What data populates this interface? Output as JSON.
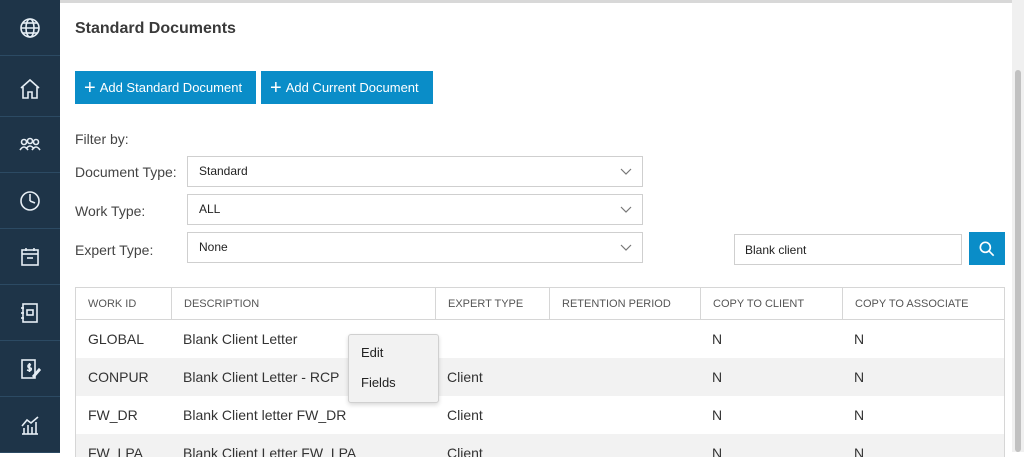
{
  "sidebar": {
    "items": [
      {
        "icon": "globe-icon"
      },
      {
        "icon": "home-icon"
      },
      {
        "icon": "users-icon"
      },
      {
        "icon": "dashboard-icon"
      },
      {
        "icon": "calendar-icon"
      },
      {
        "icon": "notebook-icon"
      },
      {
        "icon": "billing-icon"
      },
      {
        "icon": "reports-icon"
      }
    ]
  },
  "page": {
    "title": "Standard Documents"
  },
  "actions": {
    "add_standard": "Add Standard Document",
    "add_current": "Add Current Document"
  },
  "filters": {
    "heading": "Filter by:",
    "document_type_label": "Document Type:",
    "document_type_value": "Standard",
    "work_type_label": "Work Type:",
    "work_type_value": "ALL",
    "expert_type_label": "Expert Type:",
    "expert_type_value": "None"
  },
  "search": {
    "value": "Blank client"
  },
  "table": {
    "columns": [
      "WORK ID",
      "DESCRIPTION",
      "EXPERT TYPE",
      "RETENTION PERIOD",
      "COPY TO CLIENT",
      "COPY TO ASSOCIATE"
    ],
    "rows": [
      [
        "GLOBAL",
        "Blank Client Letter",
        "",
        "",
        "N",
        "N"
      ],
      [
        "CONPUR",
        "Blank Client Letter - RCP",
        "Client",
        "",
        "N",
        "N"
      ],
      [
        "FW_DR",
        "Blank Client letter FW_DR",
        "Client",
        "",
        "N",
        "N"
      ],
      [
        "FW_LPA",
        "Blank Client Letter FW_LPA",
        "Client",
        "",
        "N",
        "N"
      ]
    ]
  },
  "context_menu": {
    "items": [
      "Edit",
      "Fields"
    ]
  },
  "colors": {
    "sidebar": "#1e3448",
    "accent": "#0a8dc8"
  }
}
